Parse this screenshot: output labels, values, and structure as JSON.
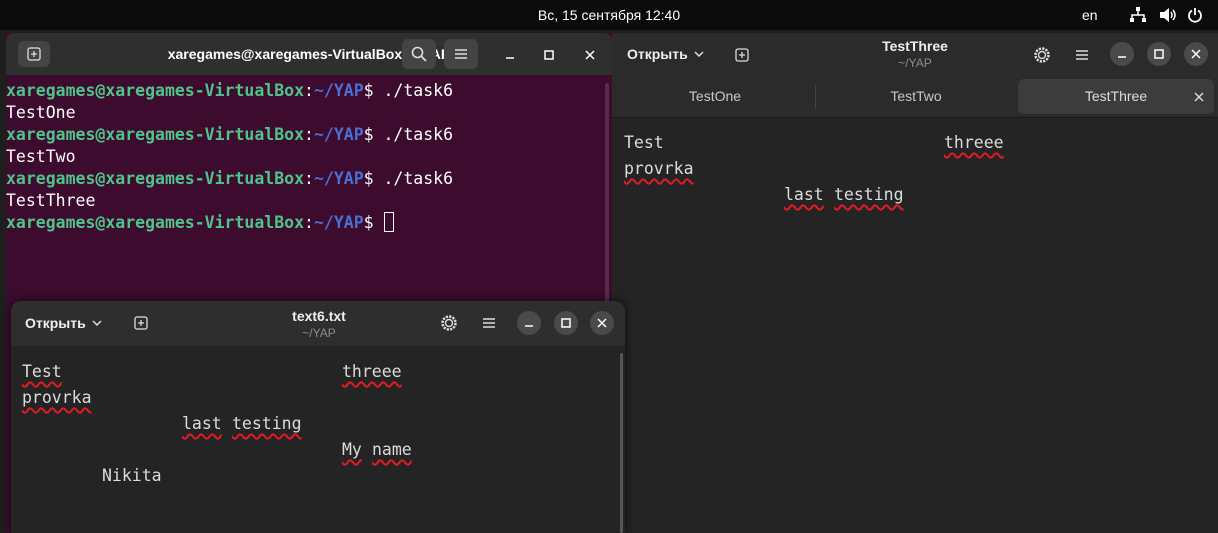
{
  "topbar": {
    "datetime": "Вс, 15 сентября  12:40",
    "lang": "en",
    "icons": [
      "network-icon",
      "volume-icon",
      "power-icon"
    ]
  },
  "terminal": {
    "title": "xaregames@xaregames-VirtualBox: ~/YAP",
    "user_host": "xaregames@xaregames-VirtualBox",
    "colon": ":",
    "path": "~/YAP",
    "dollar": "$ ",
    "lines": [
      {
        "type": "prompt",
        "cmd": "./task6"
      },
      {
        "type": "output",
        "text": "TestOne"
      },
      {
        "type": "prompt",
        "cmd": "./task6"
      },
      {
        "type": "output",
        "text": "TestTwo"
      },
      {
        "type": "prompt",
        "cmd": "./task6"
      },
      {
        "type": "output",
        "text": "TestThree"
      },
      {
        "type": "prompt",
        "cmd": ""
      }
    ]
  },
  "editor_main": {
    "open_label": "Открыть",
    "title": "TestThree",
    "subtitle": "~/YAP",
    "tabs": [
      {
        "label": "TestOne",
        "active": false
      },
      {
        "label": "TestTwo",
        "active": false
      },
      {
        "label": "TestThree",
        "active": true
      }
    ],
    "words": [
      "Test",
      "threee",
      "provrka",
      "last",
      "testing"
    ]
  },
  "editor_small": {
    "open_label": "Открыть",
    "title": "text6.txt",
    "subtitle": "~/YAP",
    "words": [
      "Test",
      "threee",
      "provrka",
      "last",
      "testing",
      "My",
      "name",
      "Nikita"
    ]
  },
  "colors": {
    "terminal_bg": "#3c0b2e",
    "prompt_user": "#4fc48a",
    "prompt_path": "#4a6fd4",
    "editor_bg": "#242424",
    "spell_underline": "#e01b24"
  }
}
